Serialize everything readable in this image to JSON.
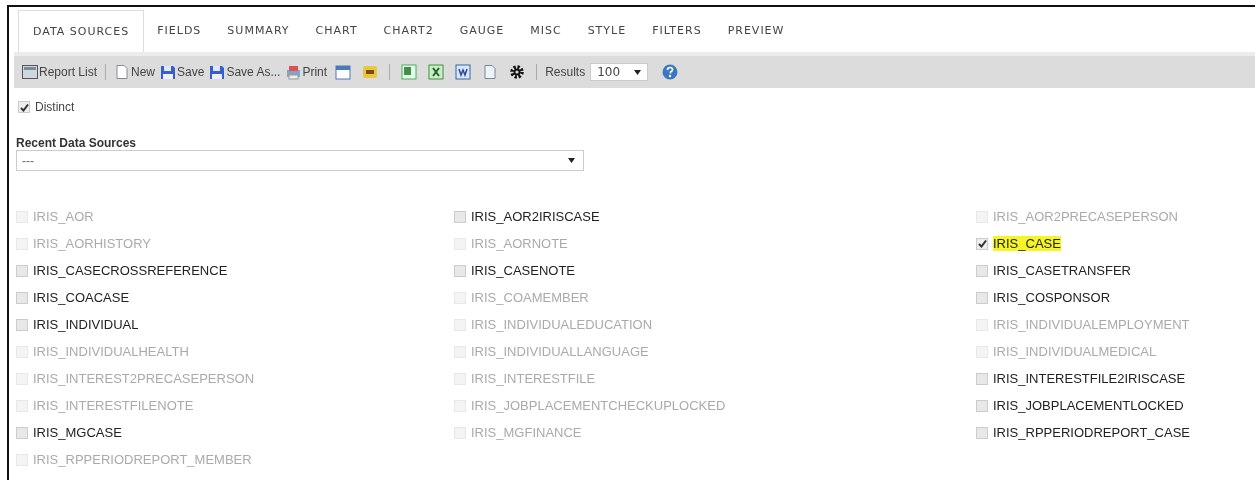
{
  "tabs": [
    {
      "label": "DATA SOURCES",
      "selected": true
    },
    {
      "label": "FIELDS",
      "selected": false
    },
    {
      "label": "SUMMARY",
      "selected": false
    },
    {
      "label": "CHART",
      "selected": false
    },
    {
      "label": "CHART2",
      "selected": false
    },
    {
      "label": "GAUGE",
      "selected": false
    },
    {
      "label": "MISC",
      "selected": false
    },
    {
      "label": "STYLE",
      "selected": false
    },
    {
      "label": "FILTERS",
      "selected": false
    },
    {
      "label": "PREVIEW",
      "selected": false
    }
  ],
  "toolbar": {
    "buttons": [
      "Report List",
      "New",
      "Save",
      "Save As...",
      "Print"
    ],
    "results_label": "Results",
    "results_value": "100"
  },
  "distinct": {
    "label": "Distinct",
    "checked": true
  },
  "recent_data_sources": {
    "label": "Recent Data Sources",
    "value": "---"
  },
  "data_sources": [
    {
      "name": "IRIS_AOR",
      "checked": false,
      "disabled": true
    },
    {
      "name": "IRIS_AOR2IRISCASE",
      "checked": false,
      "disabled": false
    },
    {
      "name": "IRIS_AOR2PRECASEPERSON",
      "checked": false,
      "disabled": true
    },
    {
      "name": "IRIS_AORHISTORY",
      "checked": false,
      "disabled": true
    },
    {
      "name": "IRIS_AORNOTE",
      "checked": false,
      "disabled": true
    },
    {
      "name": "IRIS_CASE",
      "checked": true,
      "disabled": false
    },
    {
      "name": "IRIS_CASECROSSREFERENCE",
      "checked": false,
      "disabled": false
    },
    {
      "name": "IRIS_CASENOTE",
      "checked": false,
      "disabled": false
    },
    {
      "name": "IRIS_CASETRANSFER",
      "checked": false,
      "disabled": false
    },
    {
      "name": "IRIS_COACASE",
      "checked": false,
      "disabled": false
    },
    {
      "name": "IRIS_COAMEMBER",
      "checked": false,
      "disabled": true
    },
    {
      "name": "IRIS_COSPONSOR",
      "checked": false,
      "disabled": false
    },
    {
      "name": "IRIS_INDIVIDUAL",
      "checked": false,
      "disabled": false
    },
    {
      "name": "IRIS_INDIVIDUALEDUCATION",
      "checked": false,
      "disabled": true
    },
    {
      "name": "IRIS_INDIVIDUALEMPLOYMENT",
      "checked": false,
      "disabled": true
    },
    {
      "name": "IRIS_INDIVIDUALHEALTH",
      "checked": false,
      "disabled": true
    },
    {
      "name": "IRIS_INDIVIDUALLANGUAGE",
      "checked": false,
      "disabled": true
    },
    {
      "name": "IRIS_INDIVIDUALMEDICAL",
      "checked": false,
      "disabled": true
    },
    {
      "name": "IRIS_INTEREST2PRECASEPERSON",
      "checked": false,
      "disabled": true
    },
    {
      "name": "IRIS_INTERESTFILE",
      "checked": false,
      "disabled": true
    },
    {
      "name": "IRIS_INTERESTFILE2IRISCASE",
      "checked": false,
      "disabled": false
    },
    {
      "name": "IRIS_INTERESTFILENOTE",
      "checked": false,
      "disabled": true
    },
    {
      "name": "IRIS_JOBPLACEMENTCHECKUPLOCKED",
      "checked": false,
      "disabled": true
    },
    {
      "name": "IRIS_JOBPLACEMENTLOCKED",
      "checked": false,
      "disabled": false
    },
    {
      "name": "IRIS_MGCASE",
      "checked": false,
      "disabled": false
    },
    {
      "name": "IRIS_MGFINANCE",
      "checked": false,
      "disabled": true
    },
    {
      "name": "IRIS_RPPERIODREPORT_CASE",
      "checked": false,
      "disabled": false
    },
    {
      "name": "IRIS_RPPERIODREPORT_MEMBER",
      "checked": false,
      "disabled": true
    }
  ]
}
